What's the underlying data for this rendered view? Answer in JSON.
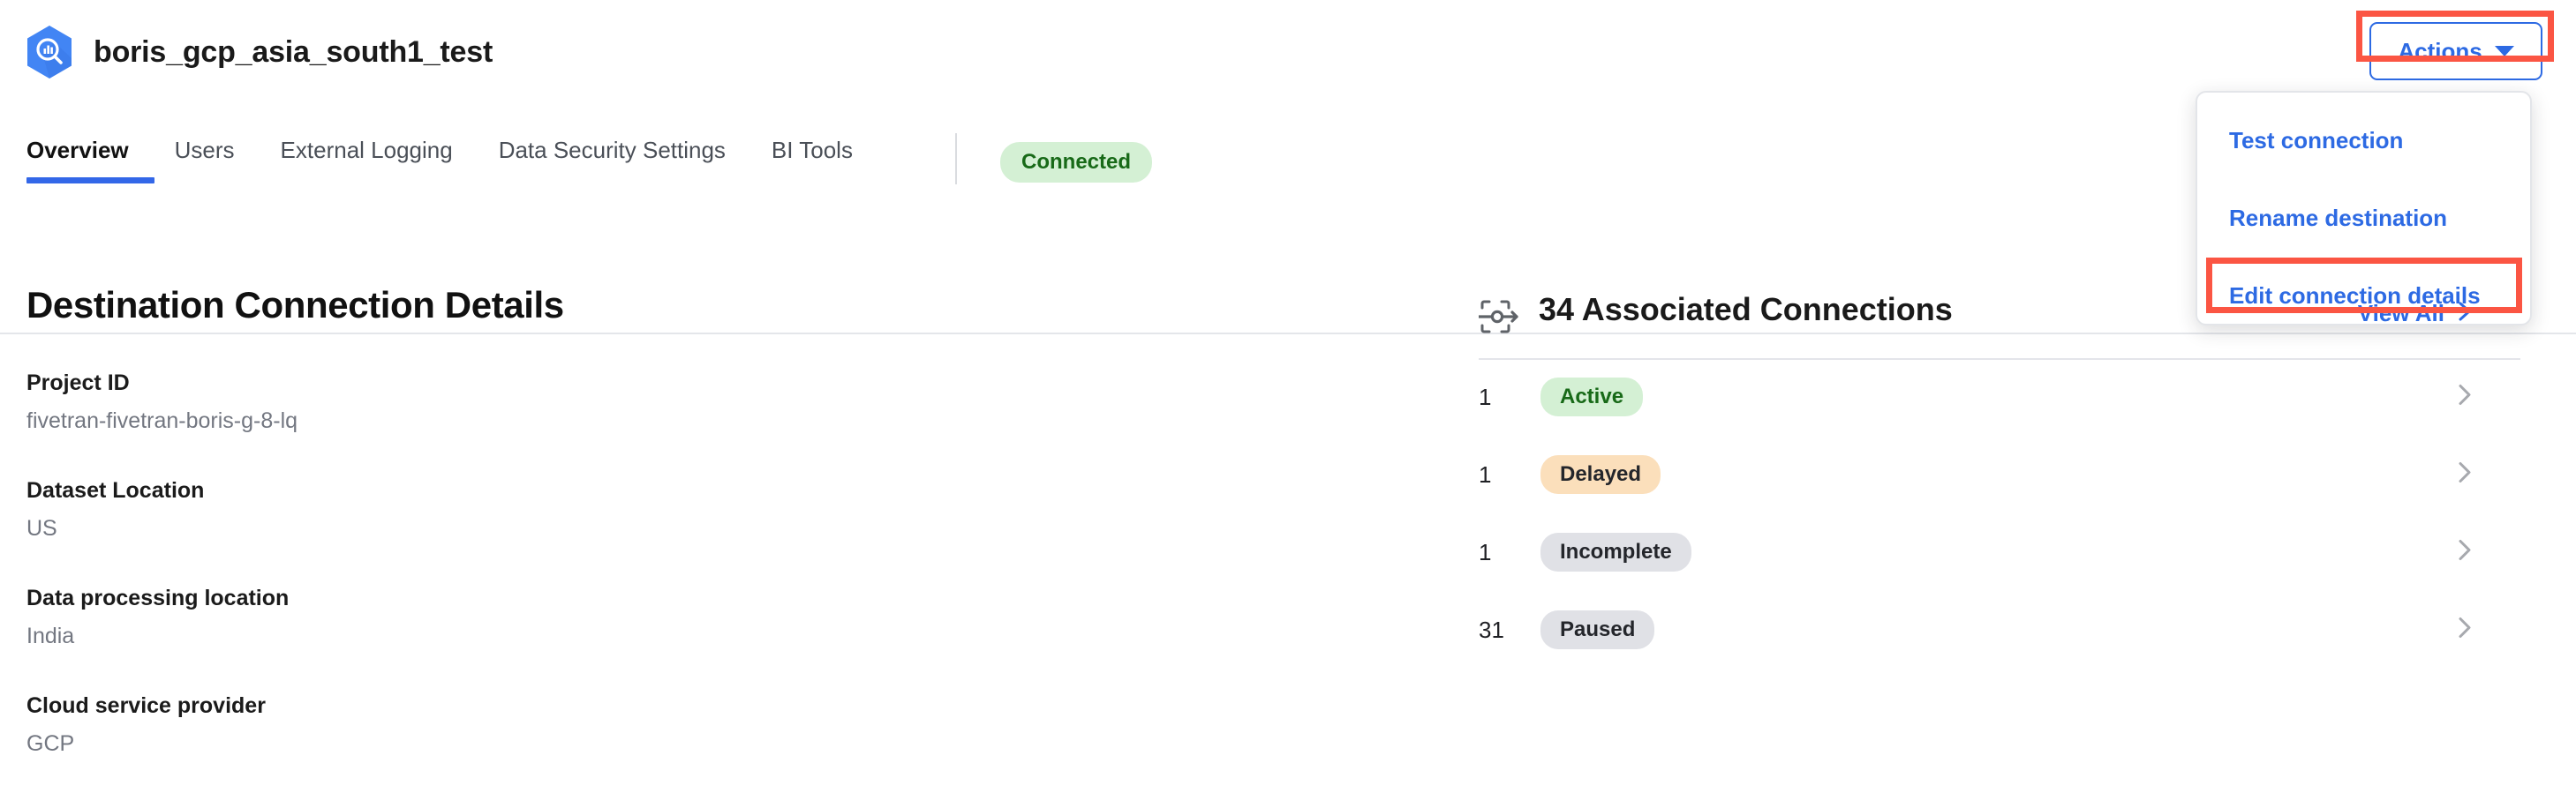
{
  "header": {
    "title": "boris_gcp_asia_south1_test",
    "icon": "bigquery-hexagon-icon"
  },
  "tabs": [
    {
      "label": "Overview",
      "active": true
    },
    {
      "label": "Users",
      "active": false
    },
    {
      "label": "External Logging",
      "active": false
    },
    {
      "label": "Data Security Settings",
      "active": false
    },
    {
      "label": "BI Tools",
      "active": false
    }
  ],
  "status_badge": {
    "label": "Connected"
  },
  "actions": {
    "button_label": "Actions",
    "caret_icon": "chevron-down-icon",
    "menu": [
      {
        "label": "Test connection"
      },
      {
        "label": "Rename destination"
      },
      {
        "label": "Edit connection details"
      }
    ]
  },
  "left_panel": {
    "title": "Destination Connection Details",
    "fields": [
      {
        "label": "Project ID",
        "value": "fivetran-fivetran-boris-g-8-lq"
      },
      {
        "label": "Dataset Location",
        "value": "US"
      },
      {
        "label": "Data processing location",
        "value": "India"
      },
      {
        "label": "Cloud service provider",
        "value": "GCP"
      }
    ]
  },
  "right_panel": {
    "icon": "connections-transfer-icon",
    "title": "34 Associated Connections",
    "view_all_label": "View All",
    "view_all_icon": "chevron-right-icon",
    "rows": [
      {
        "count": "1",
        "status": "Active",
        "style": "st-active",
        "chevron": "chevron-right-icon"
      },
      {
        "count": "1",
        "status": "Delayed",
        "style": "st-delayed",
        "chevron": "chevron-right-icon"
      },
      {
        "count": "1",
        "status": "Incomplete",
        "style": "st-grey",
        "chevron": "chevron-right-icon"
      },
      {
        "count": "31",
        "status": "Paused",
        "style": "st-grey",
        "chevron": "chevron-right-icon"
      }
    ]
  },
  "annotations": [
    {
      "target": "actions-button"
    },
    {
      "target": "edit-connection-details-menu-item"
    }
  ],
  "colors": {
    "accent_blue": "#2d6ae3",
    "tab_underline": "#3367e8",
    "annotation_red": "#fb5543",
    "status_green_bg": "#d4f0d4",
    "status_green_text": "#186a18",
    "status_orange_bg": "#fbdfbb",
    "status_grey_bg": "#e0e1e6"
  }
}
